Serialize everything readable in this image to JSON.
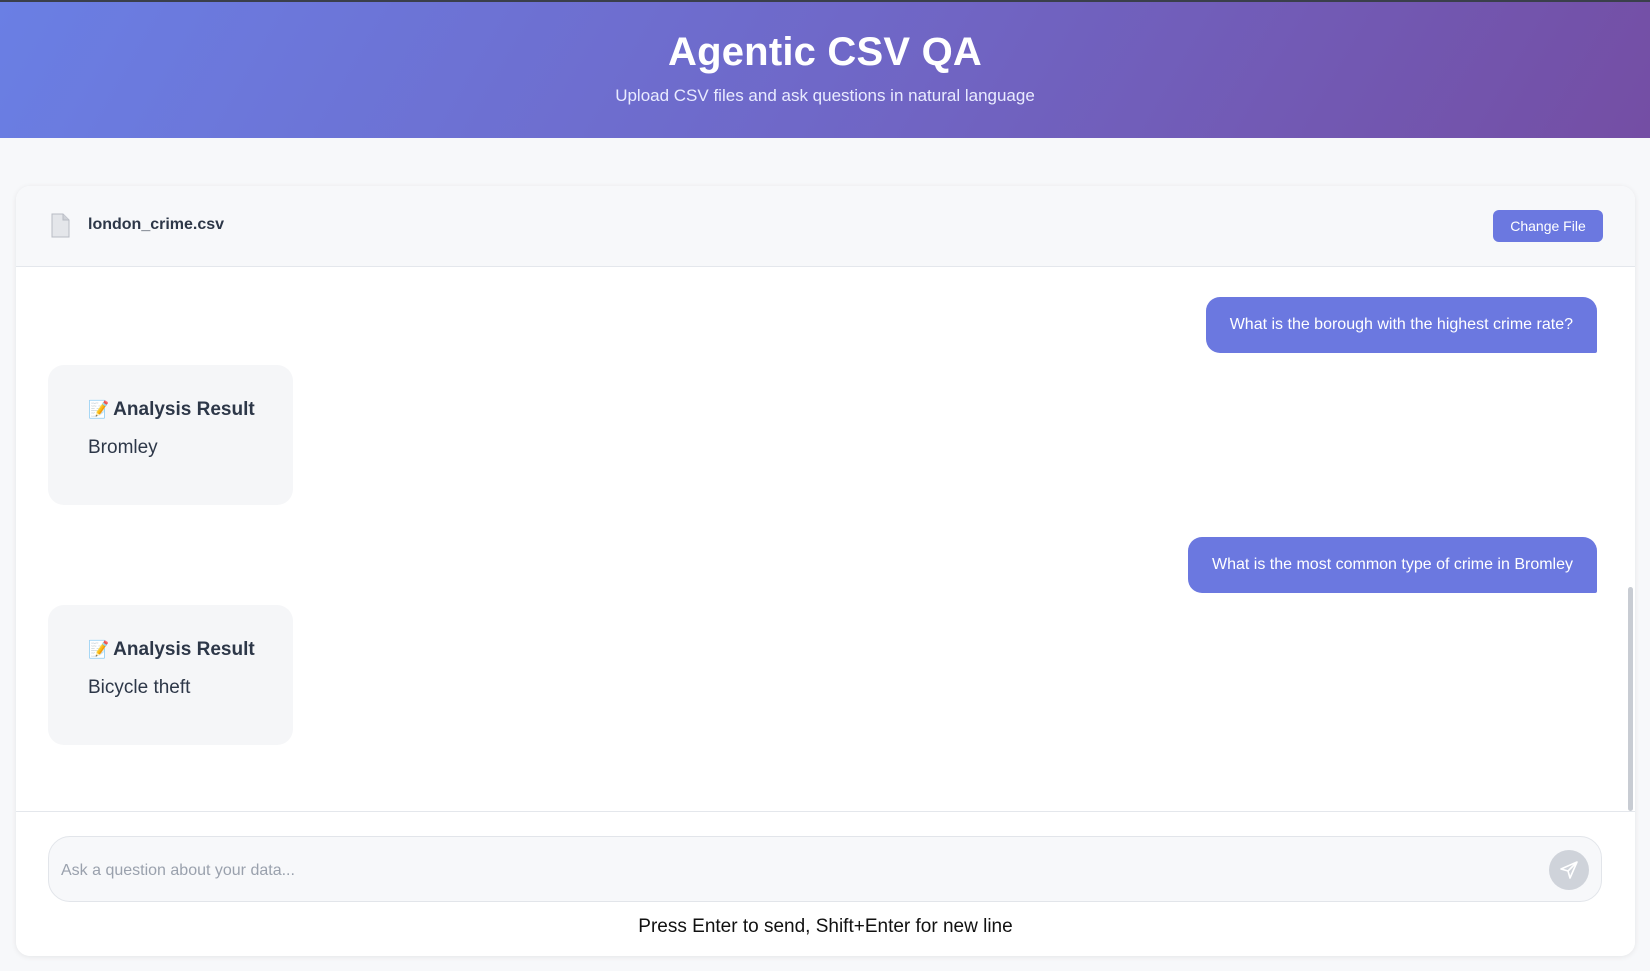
{
  "header": {
    "title": "Agentic CSV QA",
    "subtitle": "Upload CSV files and ask questions in natural language"
  },
  "file_bar": {
    "icon": "document-icon",
    "file_name": "london_crime.csv",
    "change_button": "Change File"
  },
  "messages": [
    {
      "role": "user",
      "text": "What is the borough with the highest crime rate?"
    },
    {
      "role": "assistant",
      "icon": "memo-pencil-icon",
      "title": "Analysis Result",
      "text": "Bromley"
    },
    {
      "role": "user",
      "text": "What is the most common type of crime in Bromley"
    },
    {
      "role": "assistant",
      "icon": "memo-pencil-icon",
      "title": "Analysis Result",
      "text": "Bicycle theft"
    }
  ],
  "composer": {
    "placeholder": "Ask a question about your data...",
    "send_icon": "send-icon",
    "hint": "Press Enter to send, Shift+Enter for new line"
  },
  "colors": {
    "accent": "#6b78e0",
    "header_gradient_start": "#6a7fe4",
    "header_gradient_end": "#744ea4",
    "bubble_bg": "#f5f6f8"
  }
}
